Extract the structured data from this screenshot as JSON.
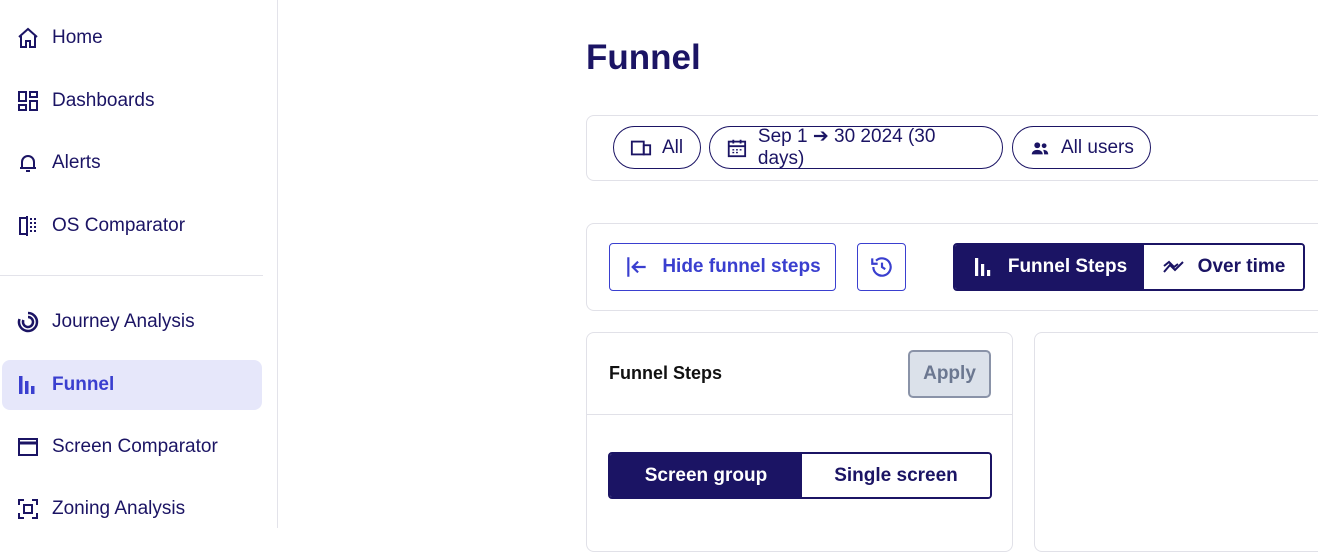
{
  "sidebar": {
    "items": [
      {
        "label": "Home",
        "icon": "home-icon"
      },
      {
        "label": "Dashboards",
        "icon": "dashboard-icon"
      },
      {
        "label": "Alerts",
        "icon": "bell-icon"
      },
      {
        "label": "OS Comparator",
        "icon": "compare-icon"
      },
      {
        "label": "Journey Analysis",
        "icon": "journey-icon"
      },
      {
        "label": "Funnel",
        "icon": "funnel-bars-icon",
        "active": true
      },
      {
        "label": "Screen Comparator",
        "icon": "window-icon"
      },
      {
        "label": "Zoning Analysis",
        "icon": "zoning-icon"
      }
    ]
  },
  "page": {
    "title": "Funnel"
  },
  "filters": {
    "device": "All",
    "date_range": "Sep 1 ➔ 30 2024 (30 days)",
    "segment": "All users"
  },
  "toolbar": {
    "hide_steps_label": "Hide funnel steps",
    "history_icon": "history-icon",
    "view_options": [
      "Funnel Steps",
      "Over time"
    ],
    "selected_view": "Funnel Steps"
  },
  "steps_panel": {
    "title": "Funnel Steps",
    "apply_label": "Apply",
    "mode_options": [
      "Screen group",
      "Single screen"
    ],
    "selected_mode": "Screen group"
  },
  "colors": {
    "primary": "#1b1464",
    "accent": "#3a3fcf",
    "active_bg": "#e6e7fa"
  }
}
